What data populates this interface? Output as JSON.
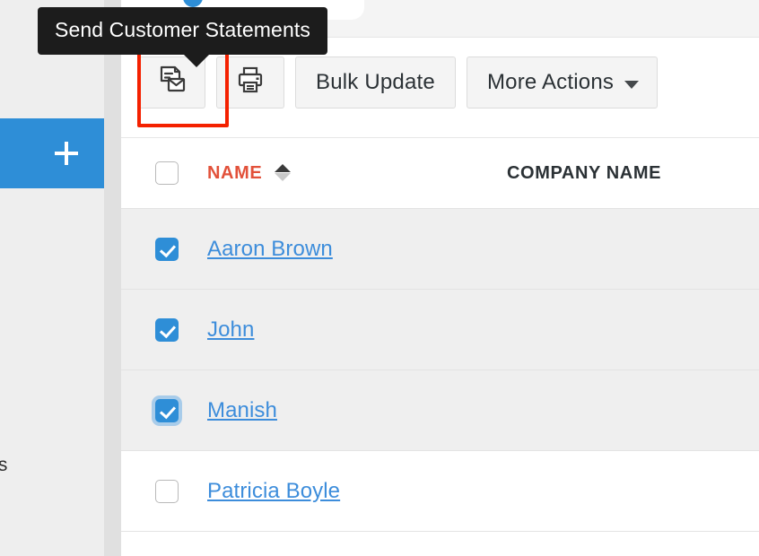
{
  "tooltip": {
    "text": "Send Customer Statements"
  },
  "sidebar": {
    "add_button_label": "+",
    "add_icon": "plus-icon",
    "partial_text": "es"
  },
  "toolbar": {
    "buttons": [
      {
        "label": "",
        "icon": "statement-email-icon",
        "highlighted": true
      },
      {
        "label": "",
        "icon": "printer-icon",
        "highlighted": false
      },
      {
        "label": "Bulk Update",
        "icon": "",
        "highlighted": false
      },
      {
        "label": "More Actions",
        "icon": "chevron-down-icon",
        "highlighted": false
      }
    ],
    "highlight_color": "#f42100"
  },
  "table": {
    "columns": [
      {
        "key": "name",
        "label": "NAME",
        "sorted": true,
        "sort_direction": "asc",
        "color": "#e2513a"
      },
      {
        "key": "company",
        "label": "COMPANY NAME",
        "sorted": false,
        "color": "#2b3135"
      }
    ],
    "select_all_checked": false,
    "rows": [
      {
        "name": "Aaron Brown",
        "company": "",
        "checked": true,
        "focused": false
      },
      {
        "name": "John",
        "company": "",
        "checked": true,
        "focused": false
      },
      {
        "name": "Manish",
        "company": "",
        "checked": true,
        "focused": true
      },
      {
        "name": "Patricia Boyle",
        "company": "",
        "checked": false,
        "focused": false
      }
    ]
  },
  "colors": {
    "accent_blue": "#2e8ed7",
    "link_blue": "#3d8ddb",
    "header_red": "#e2513a",
    "highlight_red": "#f42100",
    "selected_row": "#efefef",
    "tooltip_bg": "#1c1c1c"
  }
}
